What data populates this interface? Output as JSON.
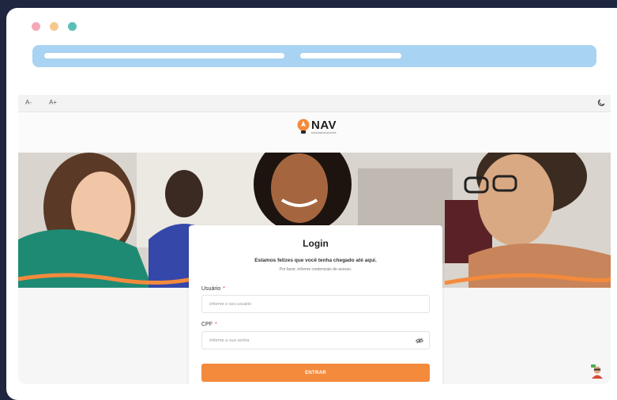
{
  "window": {
    "dot_colors": [
      "#f5a9b8",
      "#f5c98c",
      "#5bc0b4"
    ]
  },
  "toolbar": {
    "font_decrease_label": "A-",
    "font_increase_label": "A+",
    "theme_icon": "moon-icon"
  },
  "brand": {
    "name": "NAV",
    "tagline": "FAÇA ESCOLHA ATIVA",
    "logo_icon": "lightbulb-icon"
  },
  "login": {
    "title": "Login",
    "subtitle": "Estamos felizes que você tenha chegado até aqui.",
    "hint": "Por favor, informe credenciais de acesso.",
    "user_label": "Usuário",
    "user_placeholder": "Informe o seu usuário",
    "cpf_label": "CPF",
    "cpf_placeholder": "Informe a sua senha",
    "required_mark": "*",
    "submit_label": "ENTRAR",
    "reveal_icon": "eye-slash-icon"
  },
  "colors": {
    "accent": "#f48a3c",
    "required": "#e53935",
    "url_bar": "#a9d3f2",
    "frame": "#1f2640"
  }
}
